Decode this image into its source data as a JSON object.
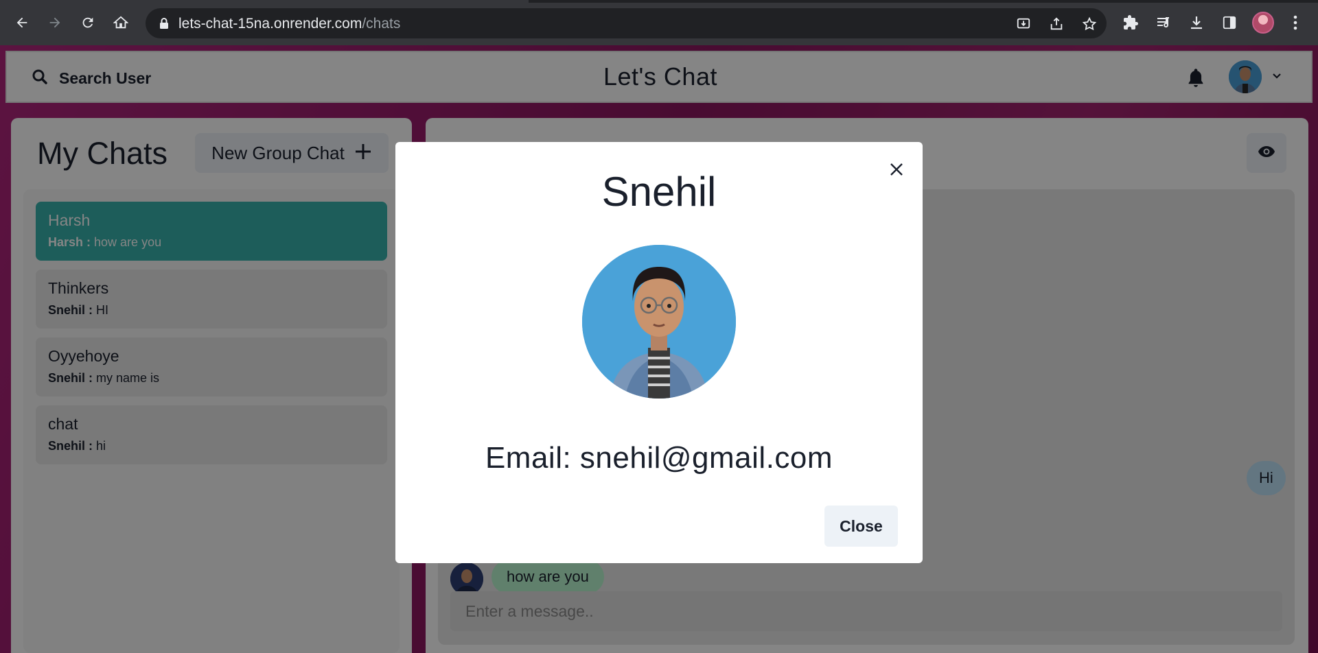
{
  "browser": {
    "url_host": "lets-chat-15na.onrender.com",
    "url_path": "/chats"
  },
  "header": {
    "search_label": "Search User",
    "app_title": "Let's Chat"
  },
  "sidebar": {
    "title": "My Chats",
    "new_group_label": "New Group Chat",
    "chats": [
      {
        "name": "Harsh",
        "sender": "Harsh :",
        "message": "how are you",
        "active": true
      },
      {
        "name": "Thinkers",
        "sender": "Snehil :",
        "message": "HI",
        "active": false
      },
      {
        "name": "Oyyehoye",
        "sender": "Snehil :",
        "message": "my name is",
        "active": false
      },
      {
        "name": "chat",
        "sender": "Snehil :",
        "message": "hi",
        "active": false
      }
    ]
  },
  "chat": {
    "messages": [
      {
        "text": "Hi",
        "own": true
      },
      {
        "text": "how are you",
        "own": false
      }
    ],
    "input_placeholder": "Enter a message.."
  },
  "modal": {
    "title": "Snehil",
    "email": "Email: snehil@gmail.com",
    "close_label": "Close"
  },
  "colors": {
    "active_chat": "#38b2ac",
    "own_message": "#bee3f8",
    "other_message": "#b9f5d0",
    "page_background": "#a3246f"
  }
}
